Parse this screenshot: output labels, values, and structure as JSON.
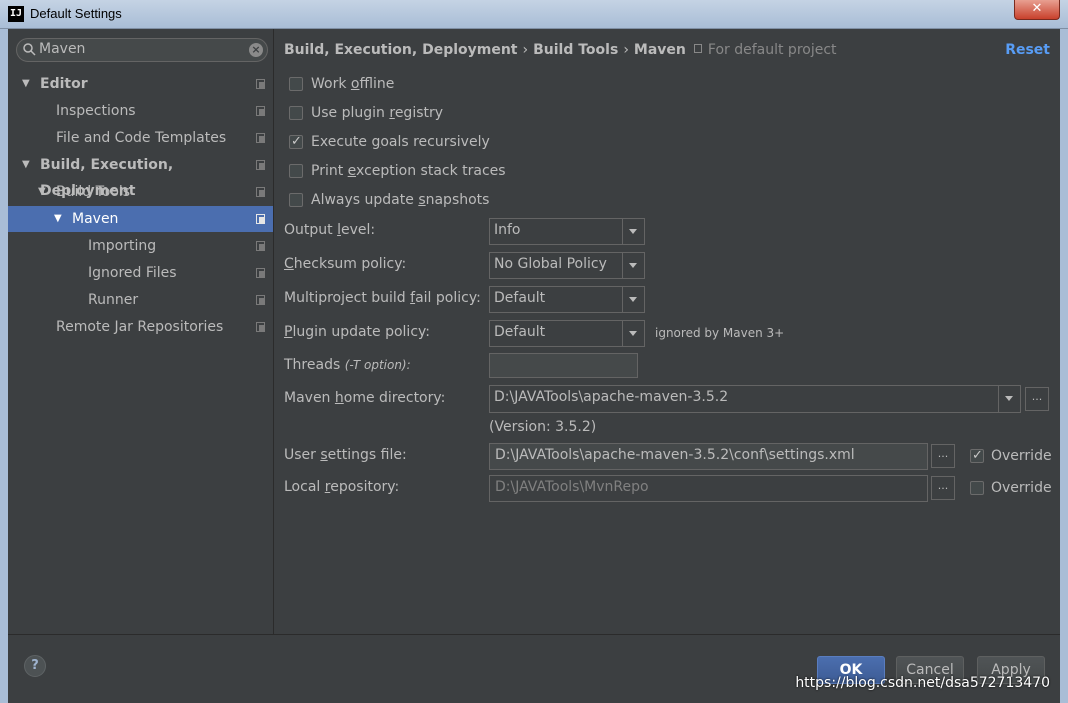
{
  "window": {
    "title": "Default Settings",
    "app_icon": "IJ",
    "close_glyph": "✕"
  },
  "search": {
    "value": "Maven"
  },
  "tree": [
    {
      "label": "Editor"
    },
    {
      "label": "Inspections"
    },
    {
      "label": "File and Code Templates"
    },
    {
      "label": "Build, Execution, Deployment"
    },
    {
      "label": "Build Tools"
    },
    {
      "label": "Maven"
    },
    {
      "label": "Importing"
    },
    {
      "label": "Ignored Files"
    },
    {
      "label": "Runner"
    },
    {
      "label": "Remote Jar Repositories"
    }
  ],
  "breadcrumb": {
    "part1": "Build, Execution, Deployment",
    "part2": "Build Tools",
    "part3": "Maven",
    "separator": "›",
    "scope": "For default project"
  },
  "reset_label": "Reset",
  "checkboxes": {
    "work_offline": {
      "pre": "Work ",
      "u": "o",
      "post": "ffline",
      "checked": false
    },
    "use_plugin_registry": {
      "pre": "Use plugin ",
      "u": "r",
      "post": "egistry",
      "checked": false
    },
    "execute_goals": {
      "pre": "Execute ",
      "u": "g",
      "post": "oals recursively",
      "checked": true
    },
    "print_exception": {
      "pre": "Print ",
      "u": "e",
      "post": "xception stack traces",
      "checked": false
    },
    "always_update": {
      "pre": "Always update ",
      "u": "s",
      "post": "napshots",
      "checked": false
    }
  },
  "fields": {
    "output_level": {
      "pre": "Output ",
      "u": "l",
      "post": "evel:",
      "value": "Info"
    },
    "checksum_policy": {
      "pre": "",
      "u": "C",
      "post": "hecksum policy:",
      "value": "No Global Policy"
    },
    "fail_policy": {
      "pre": "Multiproject build ",
      "u": "f",
      "post": "ail policy:",
      "value": "Default"
    },
    "plugin_update": {
      "pre": "",
      "u": "P",
      "post": "lugin update policy:",
      "value": "Default",
      "hint": "ignored by Maven 3+"
    },
    "threads": {
      "label": "Threads",
      "option": "(-T option):",
      "value": ""
    },
    "maven_home": {
      "pre": "Maven ",
      "u": "h",
      "post": "ome directory:",
      "value": "D:\\JAVATools\\apache-maven-3.5.2",
      "version": "(Version: 3.5.2)"
    },
    "user_settings": {
      "pre": "User ",
      "u": "s",
      "post": "ettings file:",
      "value": "D:\\JAVATools\\apache-maven-3.5.2\\conf\\settings.xml",
      "override_checked": true
    },
    "local_repo": {
      "pre": "Local ",
      "u": "r",
      "post": "epository:",
      "value": "D:\\JAVATools\\MvnRepo",
      "override_checked": false
    }
  },
  "override_label": "Override",
  "browse_glyph": "...",
  "buttons": {
    "ok": "OK",
    "cancel": "Cancel",
    "apply": "Apply",
    "help": "?"
  },
  "watermark": "https://blog.csdn.net/dsa572713470"
}
